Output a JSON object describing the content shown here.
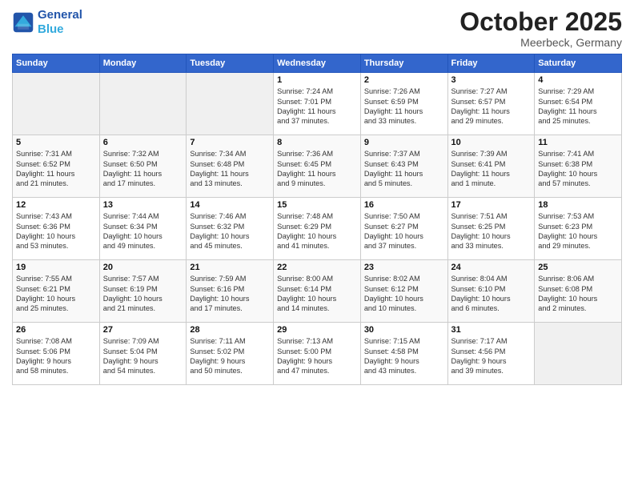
{
  "logo": {
    "line1": "General",
    "line2": "Blue"
  },
  "title": "October 2025",
  "location": "Meerbeck, Germany",
  "days_of_week": [
    "Sunday",
    "Monday",
    "Tuesday",
    "Wednesday",
    "Thursday",
    "Friday",
    "Saturday"
  ],
  "weeks": [
    [
      {
        "day": "",
        "info": ""
      },
      {
        "day": "",
        "info": ""
      },
      {
        "day": "",
        "info": ""
      },
      {
        "day": "1",
        "info": "Sunrise: 7:24 AM\nSunset: 7:01 PM\nDaylight: 11 hours\nand 37 minutes."
      },
      {
        "day": "2",
        "info": "Sunrise: 7:26 AM\nSunset: 6:59 PM\nDaylight: 11 hours\nand 33 minutes."
      },
      {
        "day": "3",
        "info": "Sunrise: 7:27 AM\nSunset: 6:57 PM\nDaylight: 11 hours\nand 29 minutes."
      },
      {
        "day": "4",
        "info": "Sunrise: 7:29 AM\nSunset: 6:54 PM\nDaylight: 11 hours\nand 25 minutes."
      }
    ],
    [
      {
        "day": "5",
        "info": "Sunrise: 7:31 AM\nSunset: 6:52 PM\nDaylight: 11 hours\nand 21 minutes."
      },
      {
        "day": "6",
        "info": "Sunrise: 7:32 AM\nSunset: 6:50 PM\nDaylight: 11 hours\nand 17 minutes."
      },
      {
        "day": "7",
        "info": "Sunrise: 7:34 AM\nSunset: 6:48 PM\nDaylight: 11 hours\nand 13 minutes."
      },
      {
        "day": "8",
        "info": "Sunrise: 7:36 AM\nSunset: 6:45 PM\nDaylight: 11 hours\nand 9 minutes."
      },
      {
        "day": "9",
        "info": "Sunrise: 7:37 AM\nSunset: 6:43 PM\nDaylight: 11 hours\nand 5 minutes."
      },
      {
        "day": "10",
        "info": "Sunrise: 7:39 AM\nSunset: 6:41 PM\nDaylight: 11 hours\nand 1 minute."
      },
      {
        "day": "11",
        "info": "Sunrise: 7:41 AM\nSunset: 6:38 PM\nDaylight: 10 hours\nand 57 minutes."
      }
    ],
    [
      {
        "day": "12",
        "info": "Sunrise: 7:43 AM\nSunset: 6:36 PM\nDaylight: 10 hours\nand 53 minutes."
      },
      {
        "day": "13",
        "info": "Sunrise: 7:44 AM\nSunset: 6:34 PM\nDaylight: 10 hours\nand 49 minutes."
      },
      {
        "day": "14",
        "info": "Sunrise: 7:46 AM\nSunset: 6:32 PM\nDaylight: 10 hours\nand 45 minutes."
      },
      {
        "day": "15",
        "info": "Sunrise: 7:48 AM\nSunset: 6:29 PM\nDaylight: 10 hours\nand 41 minutes."
      },
      {
        "day": "16",
        "info": "Sunrise: 7:50 AM\nSunset: 6:27 PM\nDaylight: 10 hours\nand 37 minutes."
      },
      {
        "day": "17",
        "info": "Sunrise: 7:51 AM\nSunset: 6:25 PM\nDaylight: 10 hours\nand 33 minutes."
      },
      {
        "day": "18",
        "info": "Sunrise: 7:53 AM\nSunset: 6:23 PM\nDaylight: 10 hours\nand 29 minutes."
      }
    ],
    [
      {
        "day": "19",
        "info": "Sunrise: 7:55 AM\nSunset: 6:21 PM\nDaylight: 10 hours\nand 25 minutes."
      },
      {
        "day": "20",
        "info": "Sunrise: 7:57 AM\nSunset: 6:19 PM\nDaylight: 10 hours\nand 21 minutes."
      },
      {
        "day": "21",
        "info": "Sunrise: 7:59 AM\nSunset: 6:16 PM\nDaylight: 10 hours\nand 17 minutes."
      },
      {
        "day": "22",
        "info": "Sunrise: 8:00 AM\nSunset: 6:14 PM\nDaylight: 10 hours\nand 14 minutes."
      },
      {
        "day": "23",
        "info": "Sunrise: 8:02 AM\nSunset: 6:12 PM\nDaylight: 10 hours\nand 10 minutes."
      },
      {
        "day": "24",
        "info": "Sunrise: 8:04 AM\nSunset: 6:10 PM\nDaylight: 10 hours\nand 6 minutes."
      },
      {
        "day": "25",
        "info": "Sunrise: 8:06 AM\nSunset: 6:08 PM\nDaylight: 10 hours\nand 2 minutes."
      }
    ],
    [
      {
        "day": "26",
        "info": "Sunrise: 7:08 AM\nSunset: 5:06 PM\nDaylight: 9 hours\nand 58 minutes."
      },
      {
        "day": "27",
        "info": "Sunrise: 7:09 AM\nSunset: 5:04 PM\nDaylight: 9 hours\nand 54 minutes."
      },
      {
        "day": "28",
        "info": "Sunrise: 7:11 AM\nSunset: 5:02 PM\nDaylight: 9 hours\nand 50 minutes."
      },
      {
        "day": "29",
        "info": "Sunrise: 7:13 AM\nSunset: 5:00 PM\nDaylight: 9 hours\nand 47 minutes."
      },
      {
        "day": "30",
        "info": "Sunrise: 7:15 AM\nSunset: 4:58 PM\nDaylight: 9 hours\nand 43 minutes."
      },
      {
        "day": "31",
        "info": "Sunrise: 7:17 AM\nSunset: 4:56 PM\nDaylight: 9 hours\nand 39 minutes."
      },
      {
        "day": "",
        "info": ""
      }
    ]
  ]
}
